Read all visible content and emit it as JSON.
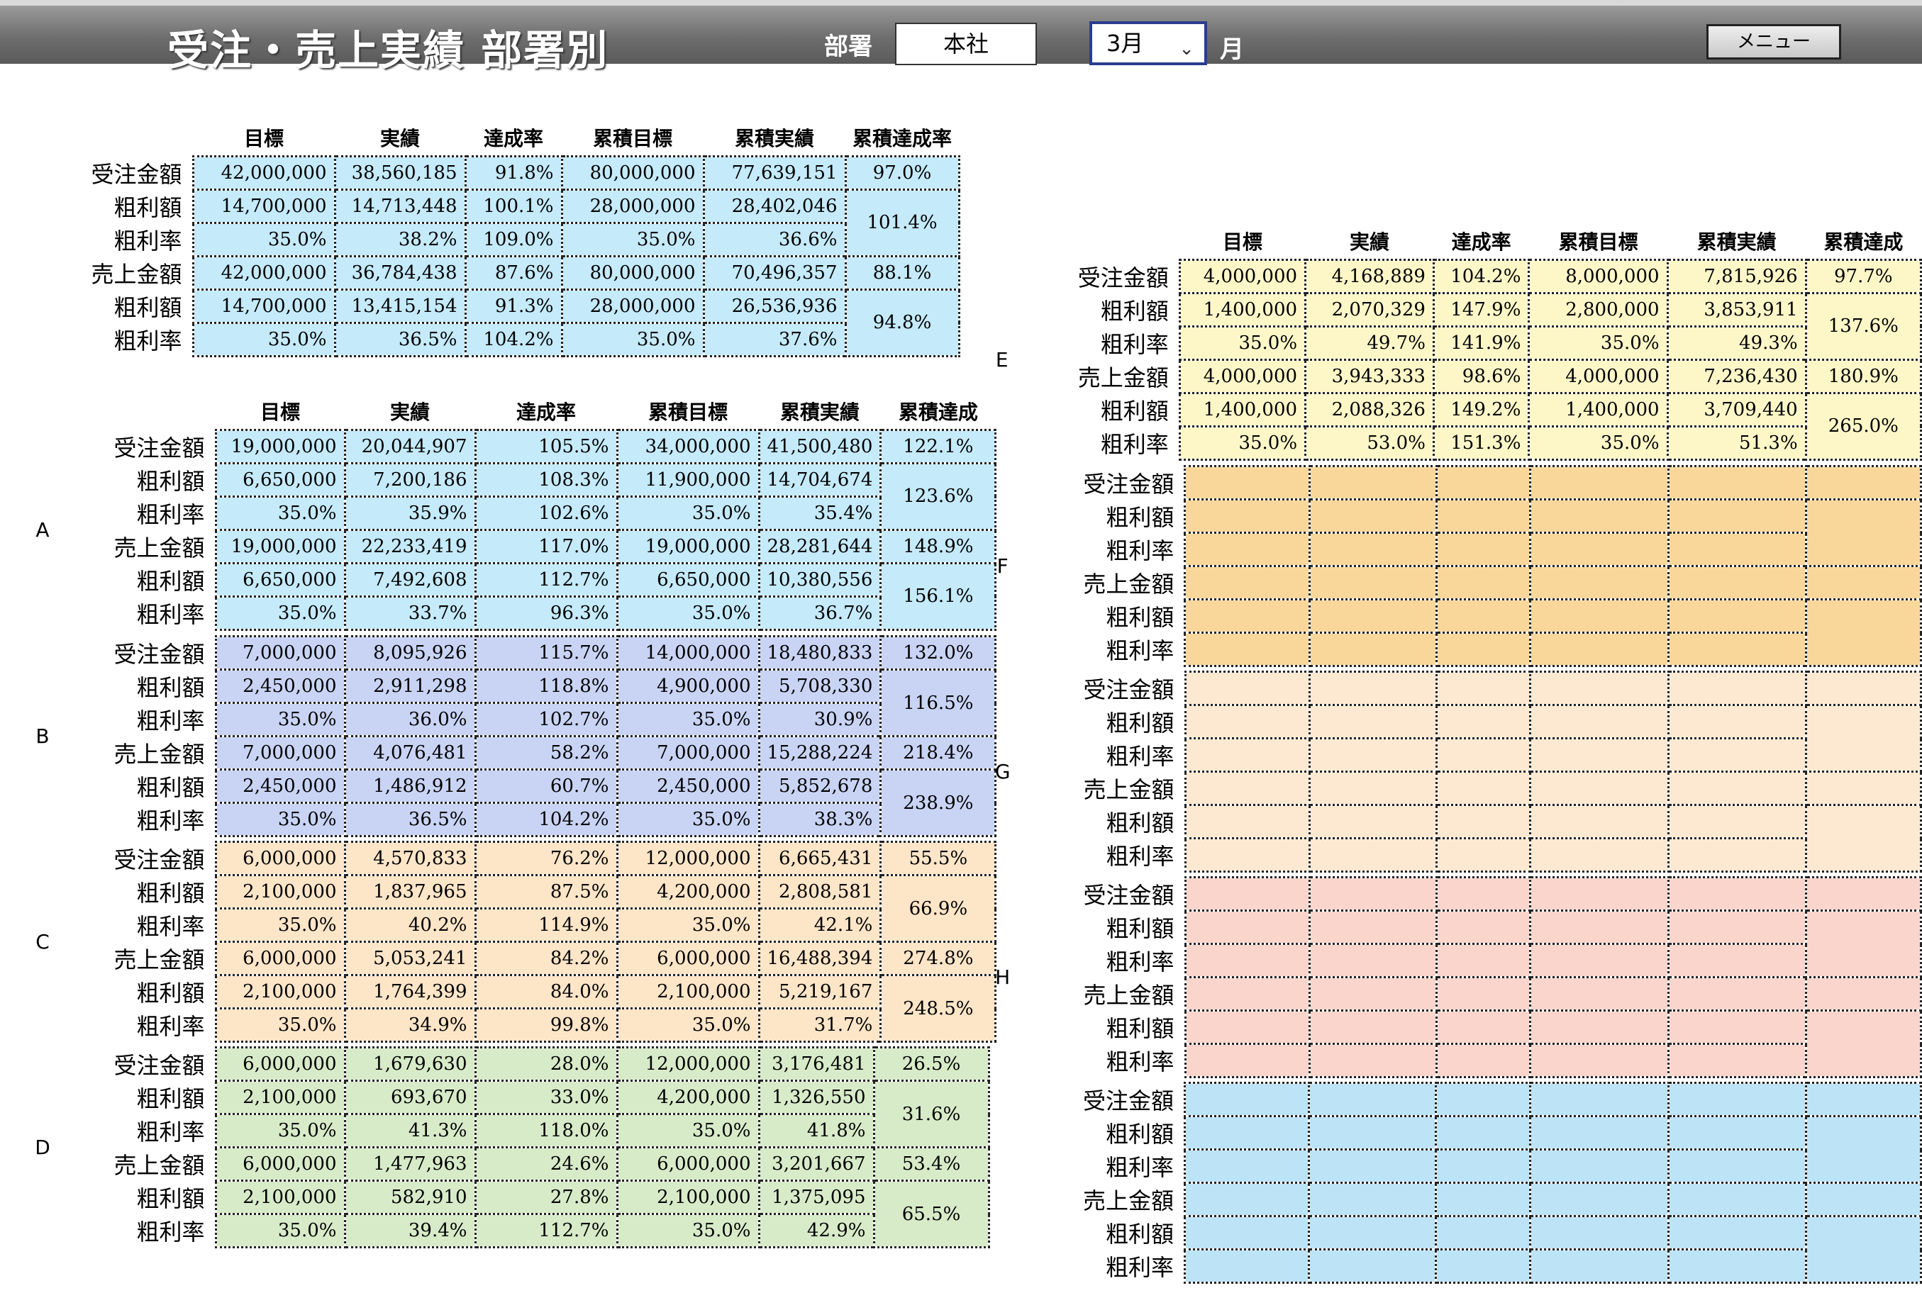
{
  "header": {
    "title": "受注・売上実績 部署別",
    "dept_label": "部署",
    "dept_value": "本社",
    "month_value": "3月",
    "month_label": "月",
    "menu_button": "メニュー"
  },
  "columns": [
    "目標",
    "実績",
    "達成率",
    "累積目標",
    "累積実績",
    "累積達成率"
  ],
  "columns_short": [
    "目標",
    "実績",
    "達成率",
    "累積目標",
    "累積実績",
    "累積達成"
  ],
  "row_labels": [
    "受注金額",
    "粗利額",
    "粗利率",
    "売上金額",
    "粗利額",
    "粗利率"
  ],
  "colors": {
    "total": "#c5eafa",
    "A": "#c5eafa",
    "B": "#c9d4f5",
    "C": "#fde5c8",
    "D": "#d8ebc9",
    "E": "#fdf7c8",
    "F": "#f9d79b",
    "G": "#fde9d1",
    "H": "#fad5cc",
    "I": "#bde3f6"
  },
  "total": {
    "rows": [
      [
        "42,000,000",
        "38,560,185",
        "91.8%",
        "80,000,000",
        "77,639,151",
        "97.0%"
      ],
      [
        "14,700,000",
        "14,713,448",
        "100.1%",
        "28,000,000",
        "28,402,046",
        "101.4%"
      ],
      [
        "35.0%",
        "38.2%",
        "109.0%",
        "35.0%",
        "36.6%",
        ""
      ],
      [
        "42,000,000",
        "36,784,438",
        "87.6%",
        "80,000,000",
        "70,496,357",
        "88.1%"
      ],
      [
        "14,700,000",
        "13,415,154",
        "91.3%",
        "28,000,000",
        "26,536,936",
        "94.8%"
      ],
      [
        "35.0%",
        "36.5%",
        "104.2%",
        "35.0%",
        "37.6%",
        ""
      ]
    ]
  },
  "sections": {
    "A": {
      "name": "A",
      "rows": [
        [
          "19,000,000",
          "20,044,907",
          "105.5%",
          "34,000,000",
          "41,500,480",
          "122.1%"
        ],
        [
          "6,650,000",
          "7,200,186",
          "108.3%",
          "11,900,000",
          "14,704,674",
          "123.6%"
        ],
        [
          "35.0%",
          "35.9%",
          "102.6%",
          "35.0%",
          "35.4%",
          ""
        ],
        [
          "19,000,000",
          "22,233,419",
          "117.0%",
          "19,000,000",
          "28,281,644",
          "148.9%"
        ],
        [
          "6,650,000",
          "7,492,608",
          "112.7%",
          "6,650,000",
          "10,380,556",
          "156.1%"
        ],
        [
          "35.0%",
          "33.7%",
          "96.3%",
          "35.0%",
          "36.7%",
          ""
        ]
      ]
    },
    "B": {
      "name": "B",
      "rows": [
        [
          "7,000,000",
          "8,095,926",
          "115.7%",
          "14,000,000",
          "18,480,833",
          "132.0%"
        ],
        [
          "2,450,000",
          "2,911,298",
          "118.8%",
          "4,900,000",
          "5,708,330",
          "116.5%"
        ],
        [
          "35.0%",
          "36.0%",
          "102.7%",
          "35.0%",
          "30.9%",
          ""
        ],
        [
          "7,000,000",
          "4,076,481",
          "58.2%",
          "7,000,000",
          "15,288,224",
          "218.4%"
        ],
        [
          "2,450,000",
          "1,486,912",
          "60.7%",
          "2,450,000",
          "5,852,678",
          "238.9%"
        ],
        [
          "35.0%",
          "36.5%",
          "104.2%",
          "35.0%",
          "38.3%",
          ""
        ]
      ]
    },
    "C": {
      "name": "C",
      "rows": [
        [
          "6,000,000",
          "4,570,833",
          "76.2%",
          "12,000,000",
          "6,665,431",
          "55.5%"
        ],
        [
          "2,100,000",
          "1,837,965",
          "87.5%",
          "4,200,000",
          "2,808,581",
          "66.9%"
        ],
        [
          "35.0%",
          "40.2%",
          "114.9%",
          "35.0%",
          "42.1%",
          ""
        ],
        [
          "6,000,000",
          "5,053,241",
          "84.2%",
          "6,000,000",
          "16,488,394",
          "274.8%"
        ],
        [
          "2,100,000",
          "1,764,399",
          "84.0%",
          "2,100,000",
          "5,219,167",
          "248.5%"
        ],
        [
          "35.0%",
          "34.9%",
          "99.8%",
          "35.0%",
          "31.7%",
          ""
        ]
      ]
    },
    "D": {
      "name": "D",
      "rows": [
        [
          "6,000,000",
          "1,679,630",
          "28.0%",
          "12,000,000",
          "3,176,481",
          "26.5%"
        ],
        [
          "2,100,000",
          "693,670",
          "33.0%",
          "4,200,000",
          "1,326,550",
          "31.6%"
        ],
        [
          "35.0%",
          "41.3%",
          "118.0%",
          "35.0%",
          "41.8%",
          ""
        ],
        [
          "6,000,000",
          "1,477,963",
          "24.6%",
          "6,000,000",
          "3,201,667",
          "53.4%"
        ],
        [
          "2,100,000",
          "582,910",
          "27.8%",
          "2,100,000",
          "1,375,095",
          "65.5%"
        ],
        [
          "35.0%",
          "39.4%",
          "112.7%",
          "35.0%",
          "42.9%",
          ""
        ]
      ]
    },
    "E": {
      "name": "E",
      "rows": [
        [
          "4,000,000",
          "4,168,889",
          "104.2%",
          "8,000,000",
          "7,815,926",
          "97.7%"
        ],
        [
          "1,400,000",
          "2,070,329",
          "147.9%",
          "2,800,000",
          "3,853,911",
          "137.6%"
        ],
        [
          "35.0%",
          "49.7%",
          "141.9%",
          "35.0%",
          "49.3%",
          ""
        ],
        [
          "4,000,000",
          "3,943,333",
          "98.6%",
          "4,000,000",
          "7,236,430",
          "180.9%"
        ],
        [
          "1,400,000",
          "2,088,326",
          "149.2%",
          "1,400,000",
          "3,709,440",
          "265.0%"
        ],
        [
          "35.0%",
          "53.0%",
          "151.3%",
          "35.0%",
          "51.3%",
          ""
        ]
      ]
    },
    "F": {
      "name": "F"
    },
    "G": {
      "name": "G"
    },
    "H": {
      "name": "H"
    },
    "I": {
      "name": ""
    }
  }
}
